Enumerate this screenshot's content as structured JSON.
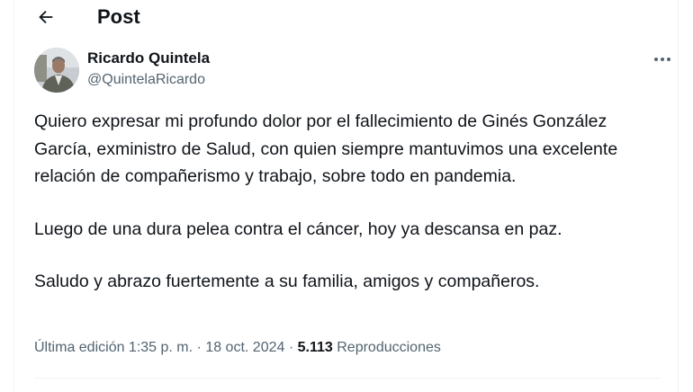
{
  "header": {
    "title": "Post",
    "back_icon": "arrow-left-icon"
  },
  "author": {
    "name": "Ricardo Quintela",
    "handle": "@QuintelaRicardo",
    "more_icon": "more-horizontal-icon"
  },
  "tweet": {
    "paragraphs": [
      "Quiero expresar mi profundo dolor por el fallecimiento de Ginés González García, exministro de Salud, con quien siempre mantuvimos una excelente relación de compañerismo y trabajo, sobre todo en pandemia.",
      "Luego de una dura pelea contra el cáncer, hoy ya descansa en paz.",
      "Saludo y abrazo fuertemente a su familia, amigos y compañeros."
    ]
  },
  "meta": {
    "edited": "Última edición 1:35 p. m.",
    "separator": "·",
    "date": "18 oct. 2024",
    "views_count": "5.113",
    "views_label": "Reproducciones"
  },
  "colors": {
    "text": "#0f1419",
    "secondary": "#536471",
    "border": "#eff3f4"
  }
}
